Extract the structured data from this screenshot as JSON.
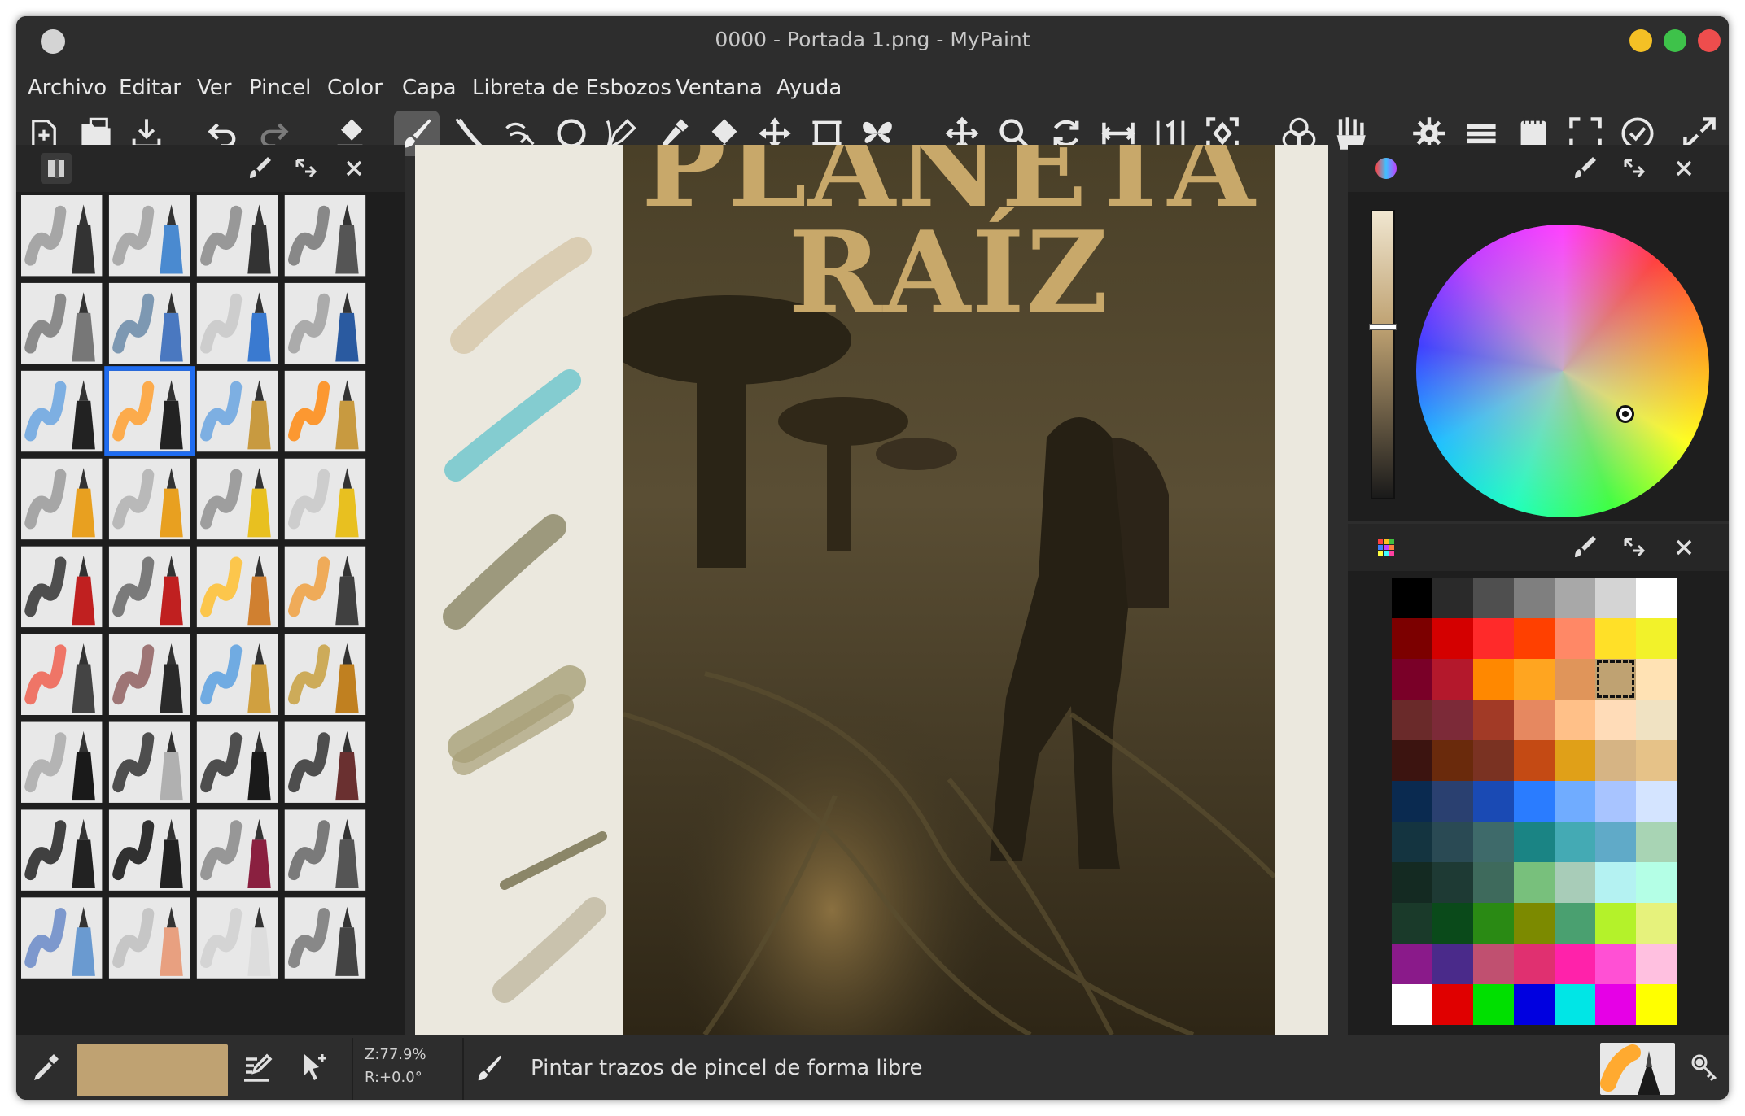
{
  "window": {
    "title": "0000 - Portada 1.png - MyPaint",
    "controls": {
      "minimize_color": "#f4c025",
      "maximize_color": "#3ec24a",
      "close_color": "#ee4d4d"
    }
  },
  "menu": [
    "Archivo",
    "Editar",
    "Ver",
    "Pincel",
    "Color",
    "Capa",
    "Libreta de Esbozos",
    "Ventana",
    "Ayuda"
  ],
  "toolbar": {
    "tools": [
      "new-document-icon",
      "open-folder-icon",
      "save-icon",
      "undo-icon",
      "redo-icon",
      "eraser-icon",
      "brush-icon",
      "ink-icon",
      "pen-line-icon",
      "ellipse-icon",
      "pen-nib-icon",
      "color-picker-icon",
      "fill-bucket-icon",
      "move-layer-icon",
      "crop-frame-icon",
      "symmetry-butterfly-icon",
      "pan-icon",
      "zoom-icon",
      "rotate-icon",
      "flip-icon",
      "reset-zoom-icon",
      "fit-icon",
      "color-circles-icon",
      "brushes-hand-icon",
      "settings-gear-icon",
      "layers-icon",
      "scratchpad-icon",
      "fullscreen-icon",
      "history-clock-icon",
      "expand-icon"
    ],
    "active_tool": "brush-icon"
  },
  "canvas": {
    "poster_title_line1": "PLANETA",
    "poster_title_line2": "RAÍZ",
    "background_color": "#ebe8de",
    "poster_tone": "#3c3420"
  },
  "left_panel": {
    "selected_brush_index": 9
  },
  "color_panel": {
    "current_color": "#bfa272"
  },
  "palette": {
    "rows": [
      [
        "#000000",
        "#2a2a2a",
        "#4f4f4f",
        "#7f7f7f",
        "#a8a8a8",
        "#d4d4d4",
        "#ffffff"
      ],
      [
        "#7c0000",
        "#d40000",
        "#ff2a2a",
        "#ff4000",
        "#ff8866",
        "#ffe028",
        "#f2f22a"
      ],
      [
        "#7a0028",
        "#b4182c",
        "#ff8800",
        "#ffa520",
        "#e0955a",
        "#bfa272",
        "#ffe2b4"
      ],
      [
        "#6a2a2a",
        "#7c2a38",
        "#a23a26",
        "#e68860",
        "#ffc088",
        "#ffdcb8",
        "#f0e2c2"
      ],
      [
        "#3c1410",
        "#6a2a0c",
        "#7a3222",
        "#c44a14",
        "#e0a018",
        "#d6b484",
        "#e6c288"
      ],
      [
        "#0a2a50",
        "#2a4070",
        "#1a4ab4",
        "#2a7cff",
        "#70acff",
        "#a8c4ff",
        "#d4e4ff"
      ],
      [
        "#143440",
        "#2a4a54",
        "#3e6a6a",
        "#1a8484",
        "#44aab4",
        "#60aac8",
        "#a8d4b4"
      ],
      [
        "#142a22",
        "#1e3a34",
        "#3e6a5c",
        "#78c07c",
        "#a8ccb8",
        "#b4f2f2",
        "#b4ffe6"
      ],
      [
        "#1a3a2a",
        "#0a4a1a",
        "#2a8a14",
        "#7c8a00",
        "#4aa070",
        "#b4f22a",
        "#e6f27c"
      ],
      [
        "#8a1a8a",
        "#4a2a8a",
        "#c05070",
        "#e03070",
        "#ff22aa",
        "#ff50d4",
        "#ffc0e0"
      ],
      [
        "#ffffff",
        "#e00000",
        "#00e000",
        "#0000e0",
        "#00e6e6",
        "#e600e6",
        "#ffff00"
      ]
    ],
    "selected": [
      2,
      5
    ]
  },
  "status": {
    "zoom": "Z:77.9%",
    "rotation": "R:+0.0°",
    "message": "Pintar trazos de pincel de forma libre",
    "current_color": "#bfa272"
  }
}
